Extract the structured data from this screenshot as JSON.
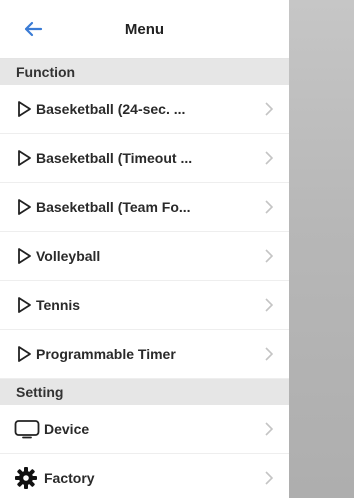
{
  "header": {
    "title": "Menu",
    "back_icon": "back-arrow-icon"
  },
  "sections": {
    "function": {
      "label": "Function",
      "items": [
        {
          "label": "Baseketball (24-sec. ..."
        },
        {
          "label": "Baseketball (Timeout ..."
        },
        {
          "label": "Baseketball (Team Fo..."
        },
        {
          "label": "Volleyball"
        },
        {
          "label": "Tennis"
        },
        {
          "label": "Programmable Timer"
        }
      ]
    },
    "setting": {
      "label": "Setting",
      "items": [
        {
          "label": "Device",
          "icon": "monitor-icon"
        },
        {
          "label": "Factory",
          "icon": "gear-icon"
        }
      ]
    }
  },
  "colors": {
    "accent": "#3a7bd5",
    "section_bg": "#e6e6e6",
    "chevron": "#c4c4c4",
    "backdrop": "#bdbdbd"
  }
}
